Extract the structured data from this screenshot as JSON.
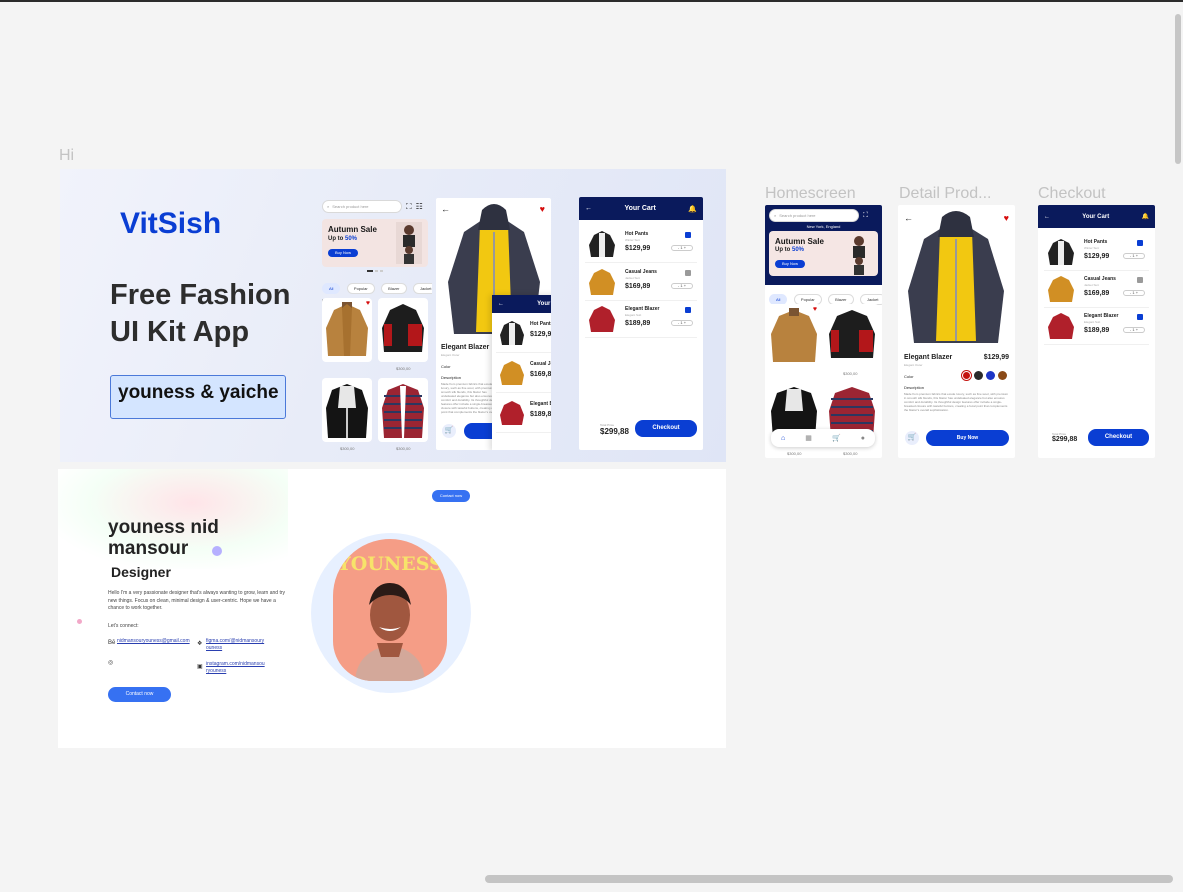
{
  "canvas": {
    "page_label": "Hi",
    "frames": [
      "Homescreen",
      "Detail Prod...",
      "Checkout"
    ]
  },
  "cover": {
    "brand": "VitSish",
    "title_line1": "Free Fashion",
    "title_line2": "UI Kit App",
    "author": "youness & yaiche"
  },
  "app": {
    "search_placeholder": "Search product here",
    "location": "New York, England",
    "banner": {
      "title": "Autumn Sale",
      "subtitle_prefix": "Up to",
      "discount": "50%",
      "button": "Buy Now"
    },
    "categories": [
      "All",
      "Popular",
      "Blazer",
      "Jacket"
    ],
    "section_label": "Elegant",
    "product_prices": [
      "$300,00",
      "$300,00",
      "$300,00",
      "$300,00"
    ],
    "detail": {
      "name": "Elegant Blazer",
      "price": "$129,99",
      "brand": "Elegant Outer",
      "color_label": "Color",
      "desc_label": "Description",
      "description": "Made from premium fabrics that exude luxury, such as fine wool, with premium in smooth silk blends, this blazer has undefeated elegance but also ensures comfort and durability. Its thoughtful design features offer include a single-breasted closure with tasteful buttons, creating a focal point that complements the blazer's overall sophistication.",
      "buy_button": "Buy Now",
      "colors": [
        "#c4130f",
        "#2b2b2b",
        "#1e36c7",
        "#8a4a17"
      ]
    },
    "cart": {
      "title": "Your Cart",
      "items": [
        {
          "name": "Hot Pants",
          "sub": "Winter Suit",
          "price": "$129,99",
          "checked": true
        },
        {
          "name": "Casual Jeans",
          "sub": "Jacket Suit",
          "price": "$169,89",
          "checked": false
        },
        {
          "name": "Elegant Blazer",
          "sub": "Elegant Suit",
          "price": "$189,89",
          "checked": true
        }
      ],
      "total_label": "Total Price",
      "total": "$299,88",
      "checkout_button": "Checkout",
      "qty": "1"
    }
  },
  "portfolio": {
    "contact_top": "Contact now",
    "name": "youness nid mansour",
    "role": "Designer",
    "bio": "Hello I'm a very passionate  designer that's always wanting to grow, learn and try new things. Focus on clean, minimal design & user-centric. Hope we have a chance to work together.",
    "connect_label": "Let's connect:",
    "email": "nidmansouryouness@gmail.com",
    "figma": "figma.com/@nidmansouryouness",
    "instagram": "instagram.com/nidmansouryouness",
    "contact_button": "Contact now",
    "avatar_text": "YOUNESS"
  },
  "colors": {
    "brand_blue": "#0a3ed3",
    "navy": "#0a1a5c",
    "accent_blue": "#3671f2",
    "heart": "#d60d0d"
  }
}
